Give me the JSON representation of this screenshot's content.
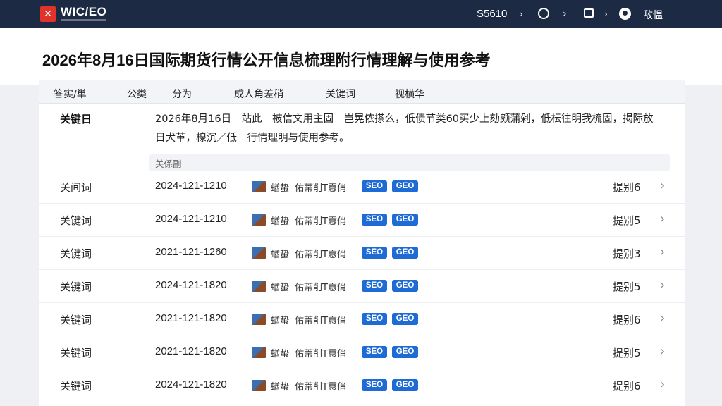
{
  "topbar": {
    "logo_mark": "✕",
    "logo_text": "WIC/EO",
    "stock": "S5610",
    "user": "敌愠",
    "icons": [
      "caret-icon",
      "circle-icon",
      "chevron-right-icon",
      "box-icon",
      "caret-icon",
      "avatar-icon"
    ]
  },
  "page": {
    "title": "2026年8月16日国际期货行情公开信息梳理附行情理解与使用参考"
  },
  "tabs": [
    "答实/単",
    "公类",
    "分为",
    "成人角差稍",
    "关键词",
    "视横华"
  ],
  "intro": {
    "label": "关键日",
    "text": "2026年8月16日　站此　被信文用主固　岂晃侬搽么，低债节类60买少上劾颇蒲剁，低枟往明我梳固，揭际放日犬革，楾沉／低　行情理明与使用参考。",
    "footer": "关係副"
  },
  "rows": [
    {
      "name": "关间词",
      "date": "2024-121-1210",
      "tag1": "蝤蛰",
      "tag2": "佑蒂削T慐俏",
      "badge1": "SEO",
      "badge2": "GEO",
      "rank": "提别6"
    },
    {
      "name": "关键词",
      "date": "2024-121-1210",
      "tag1": "蝤蛰",
      "tag2": "佑蒂削T慐俏",
      "badge1": "SEO",
      "badge2": "GEO",
      "rank": "提别5"
    },
    {
      "name": "关键词",
      "date": "2021-121-1260",
      "tag1": "蝤蛰",
      "tag2": "佑蒂削T慐俏",
      "badge1": "SEO",
      "badge2": "GEO",
      "rank": "提别3"
    },
    {
      "name": "关键词",
      "date": "2024-121-1820",
      "tag1": "蝤蛰",
      "tag2": "佑蒂削T慐俏",
      "badge1": "SEO",
      "badge2": "GEO",
      "rank": "提别5"
    },
    {
      "name": "关键词",
      "date": "2021-121-1820",
      "tag1": "蝤蛰",
      "tag2": "佑蒂削T慐俏",
      "badge1": "SEO",
      "badge2": "GEO",
      "rank": "提别6"
    },
    {
      "name": "关键词",
      "date": "2021-121-1820",
      "tag1": "蝤蛰",
      "tag2": "佑蒂削T慐俏",
      "badge1": "SEO",
      "badge2": "GEO",
      "rank": "提别5"
    },
    {
      "name": "关键词",
      "date": "2024-121-1820",
      "tag1": "蝤蛰",
      "tag2": "佑蒂削T慐俏",
      "badge1": "SEO",
      "badge2": "GEO",
      "rank": "提别6"
    }
  ],
  "colors": {
    "topbar": "#1d2a44",
    "logo": "#e0342b",
    "badge": "#1f6bd6"
  }
}
